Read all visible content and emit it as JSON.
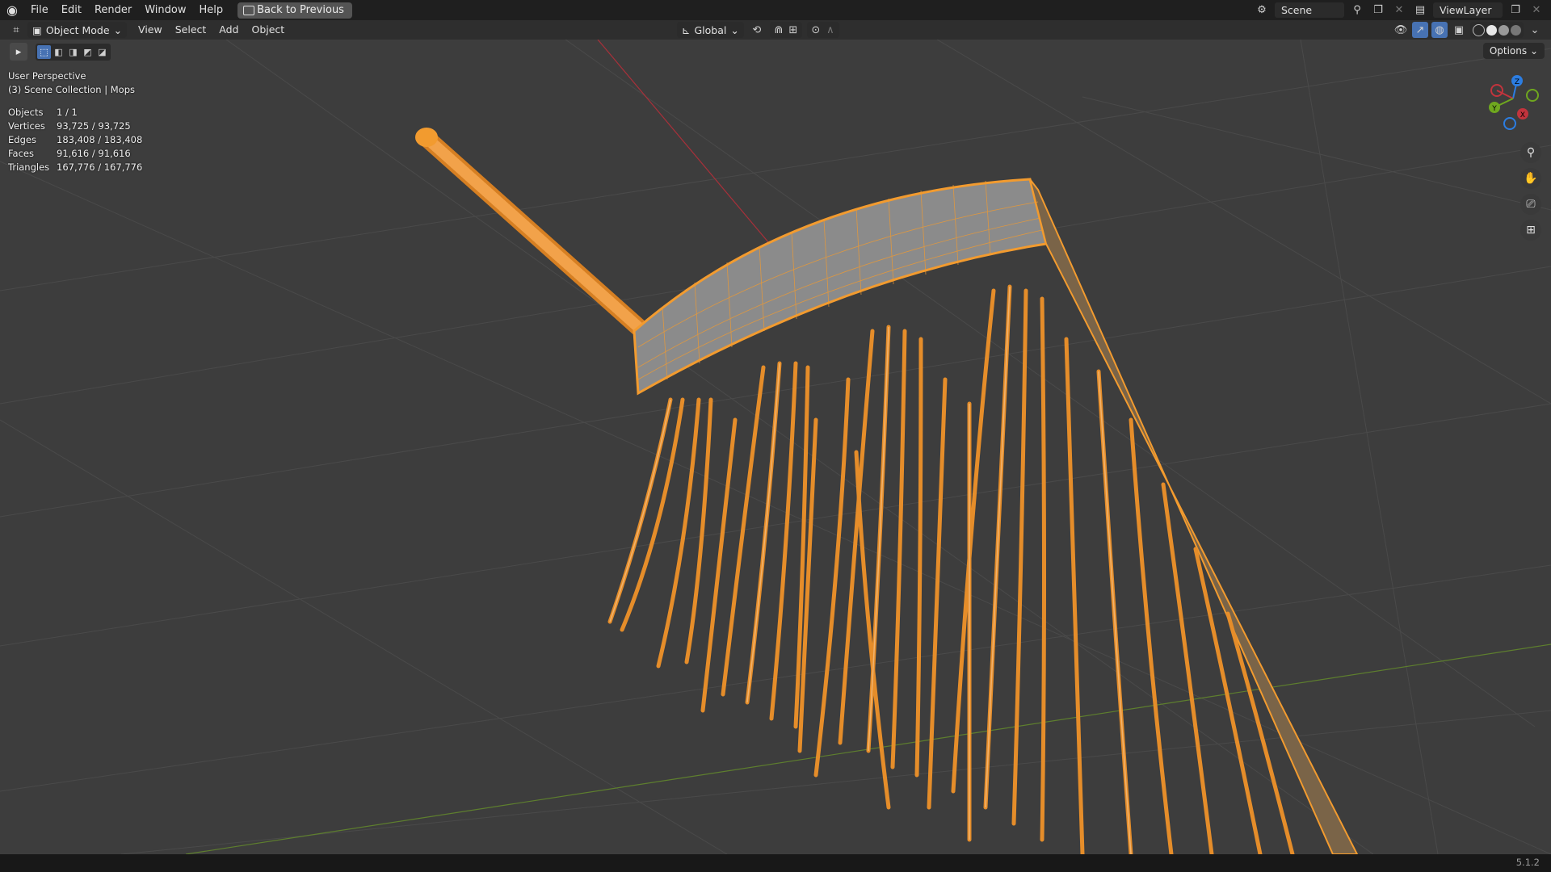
{
  "topbar": {
    "menu": [
      "File",
      "Edit",
      "Render",
      "Window",
      "Help"
    ],
    "back_button": "Back to Previous",
    "scene_name": "Scene",
    "view_layer": "ViewLayer"
  },
  "header": {
    "mode": "Object Mode",
    "menu": [
      "View",
      "Select",
      "Add",
      "Object"
    ],
    "orientation": "Global",
    "options_label": "Options"
  },
  "viewport": {
    "perspective": "User Perspective",
    "collection": "(3) Scene Collection | Mops",
    "stats": [
      {
        "label": "Objects",
        "value": "1 / 1"
      },
      {
        "label": "Vertices",
        "value": "93,725 / 93,725"
      },
      {
        "label": "Edges",
        "value": "183,408 / 183,408"
      },
      {
        "label": "Faces",
        "value": "91,616 / 91,616"
      },
      {
        "label": "Triangles",
        "value": "167,776 / 167,776"
      }
    ],
    "gizmo_axes": [
      "Z",
      "Y",
      "X"
    ]
  },
  "status": {
    "version": "5.1.2"
  },
  "colors": {
    "selection": "#f29b2f",
    "x_axis": "#c2343d",
    "y_axis": "#6fa71f",
    "z_axis": "#2c7de1",
    "active_mode": "#4772b3"
  }
}
